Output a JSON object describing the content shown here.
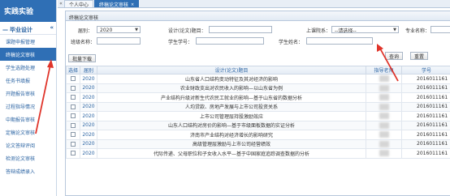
{
  "sidebar": {
    "brand": "实践实验",
    "section": {
      "label": "毕业设计",
      "collapse": "«"
    },
    "items": [
      {
        "label": "课题申报管理",
        "active": false
      },
      {
        "label": "终稿论文审核",
        "active": true
      },
      {
        "label": "学生选题处理",
        "active": false
      },
      {
        "label": "任务书填报",
        "active": false
      },
      {
        "label": "开题报告审核",
        "active": false
      },
      {
        "label": "过程指导情况",
        "active": false
      },
      {
        "label": "中期报告审核",
        "active": false
      },
      {
        "label": "定稿论文审核",
        "active": false
      },
      {
        "label": "论文答辩评阅",
        "active": false
      },
      {
        "label": "检测论文审核",
        "active": false
      },
      {
        "label": "答辩成绩录入",
        "active": false
      }
    ]
  },
  "tabs": {
    "nav_left": "«",
    "nav_right": "»",
    "items": [
      {
        "label": "个人中心",
        "active": false
      },
      {
        "label": "终稿论文审核",
        "active": true,
        "close": "×"
      }
    ]
  },
  "panel": {
    "title": "终稿论文审核"
  },
  "filter": {
    "grade_label": "届别：",
    "grade_value": "2020",
    "topic_label": "设计(论文)题目：",
    "topic_value": "",
    "dept_label": "上课院系：",
    "dept_value": "--请选择--",
    "major_label": "专业名称：",
    "major_value": "",
    "class_label": "班级名称：",
    "class_value": "",
    "studentno_label": "学生学号：",
    "studentno_value": "",
    "studentname_label": "学生姓名：",
    "studentname_value": "",
    "query_button": "查询",
    "reset_button": "重置"
  },
  "batch_button": "批量下载",
  "table": {
    "headers": [
      "选择",
      "届别",
      "设计(论文)题目",
      "指导老师",
      "学号"
    ],
    "rows": [
      {
        "year": "2020",
        "title": "山东省人口结构变动特征及其对经济的影响",
        "sid": "2016011161"
      },
      {
        "year": "2020",
        "title": "农业财政支出对农民收入的影响—以山东省为例",
        "sid": "2016011161"
      },
      {
        "year": "2020",
        "title": "产业结构升级对新生代农民工就业的影响—基于山东省的数据分析",
        "sid": "2016011161"
      },
      {
        "year": "2020",
        "title": "人均贷款、房地产发展与上市公司投资关系",
        "sid": "2016011161"
      },
      {
        "year": "2020",
        "title": "上市公司管理层持股激励效应",
        "sid": "2016011161"
      },
      {
        "year": "2020",
        "title": "山东人口结构对房价的影响—基于市级面板数据的实证分析",
        "sid": "2016011161"
      },
      {
        "year": "2020",
        "title": "济南市产业结构对经济增长的影响研究",
        "sid": "2016011161"
      },
      {
        "year": "2020",
        "title": "高级管理层激励与上市公司经营绩效",
        "sid": "2016011161"
      },
      {
        "year": "2020",
        "title": "代际传递、父母职位和子女收入水平—基于中国家庭追踪调查数据的分析",
        "sid": "2016011161"
      }
    ]
  },
  "colors": {
    "accent": "#2f6fb5",
    "annotation": "#e0342a"
  }
}
